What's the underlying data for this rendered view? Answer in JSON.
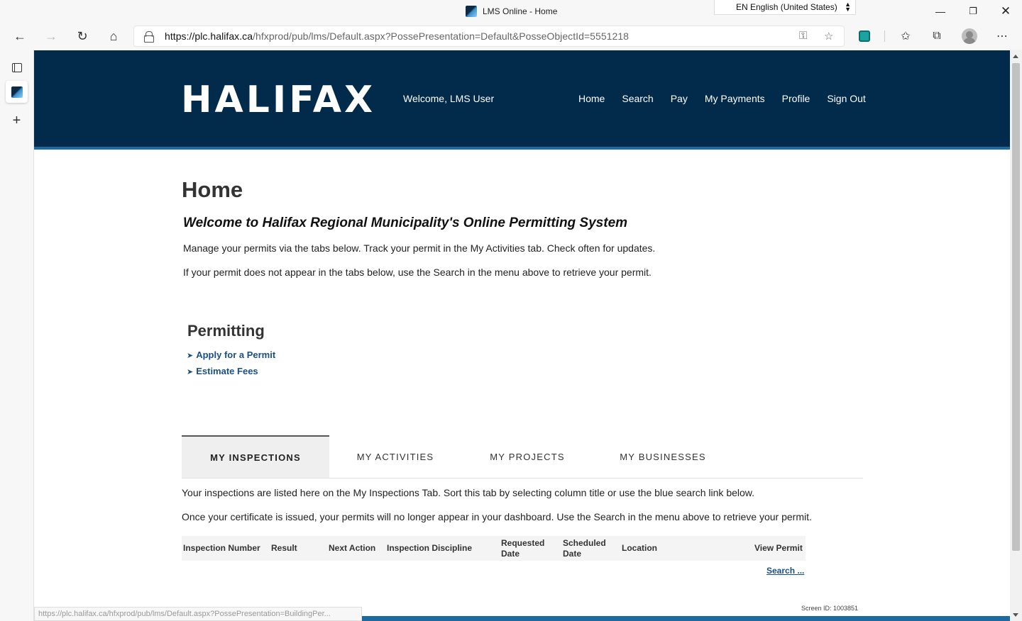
{
  "browser": {
    "window_title": "LMS Online - Home",
    "language_selector": "EN English (United States)",
    "url_host": "https://plc.halifax.ca",
    "url_path": "/hfxprod/pub/lms/Default.aspx?PossePresentation=Default&PosseObjectId=5551218",
    "status_url": "https://plc.halifax.ca/hfxprod/pub/lms/Default.aspx?PossePresentation=BuildingPer..."
  },
  "header": {
    "logo": "HALIFAX",
    "welcome": "Welcome, LMS User",
    "nav": [
      "Home",
      "Search",
      "Pay",
      "My Payments",
      "Profile",
      "Sign Out"
    ]
  },
  "page": {
    "title": "Home",
    "welcome_heading": "Welcome to Halifax Regional Municipality's Online Permitting System",
    "intro": [
      "Manage your permits via the tabs below. Track your permit in the My Activities tab. Check often for updates.",
      "If your permit does not appear in the tabs below, use the Search in the menu above to retrieve your permit."
    ]
  },
  "permitting": {
    "title": "Permitting",
    "arrow": "➤",
    "links": [
      "Apply for a Permit",
      "Estimate Fees"
    ]
  },
  "tabs": [
    "MY INSPECTIONS",
    "MY ACTIVITIES",
    "MY PROJECTS",
    "MY BUSINESSES"
  ],
  "inspections": {
    "desc": [
      "Your inspections are listed here on the My Inspections Tab. Sort this tab by selecting column title or use the blue search link below.",
      "Once your certificate is issued, your permits will no longer appear in your dashboard. Use the Search in the menu above to retrieve your permit."
    ],
    "columns": [
      "Inspection Number",
      "Result",
      "Next Action",
      "Inspection Discipline",
      "Requested Date",
      "Scheduled Date",
      "Location",
      "View Permit"
    ],
    "search_link": "Search ...",
    "screen_id": "Screen ID: 1003851"
  },
  "colors": {
    "header_bg": "#012a4b",
    "accent_band": "#1c6aa0",
    "link": "#1a4f86"
  }
}
